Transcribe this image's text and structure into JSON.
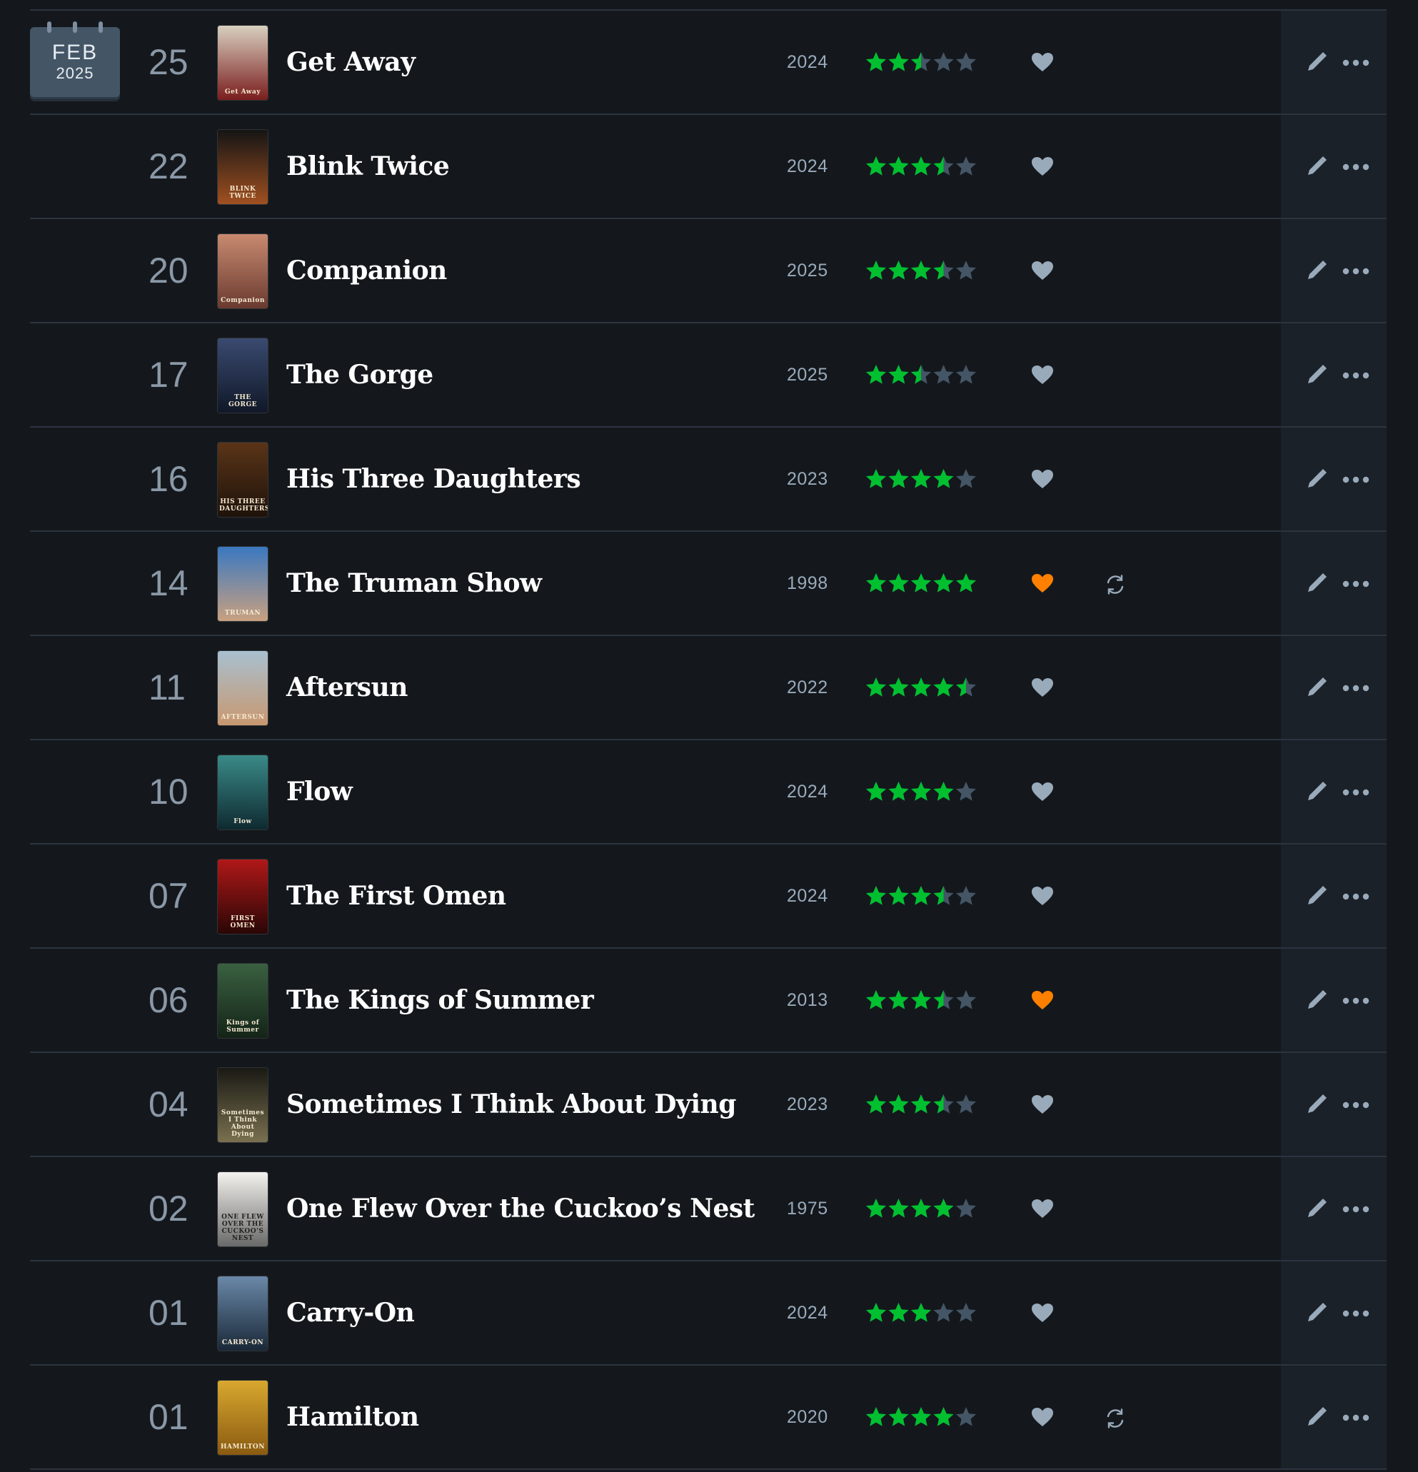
{
  "colors": {
    "background": "#14181c",
    "divider": "#2c3440",
    "star_filled": "#00c030",
    "star_empty": "#445566",
    "heart_liked": "#ff8000",
    "heart_default": "#99aabb"
  },
  "calendar": {
    "month": "FEB",
    "year": "2025"
  },
  "entries": [
    {
      "day": "25",
      "title": "Get Away",
      "year": "2024",
      "rating": 2.5,
      "liked": false,
      "rewatch": false,
      "poster_text": "Get Away",
      "poster_bg": [
        "#d8d0c0",
        "#7a1d1d"
      ]
    },
    {
      "day": "22",
      "title": "Blink Twice",
      "year": "2024",
      "rating": 3.5,
      "liked": false,
      "rewatch": false,
      "poster_text": "BLINK TWICE",
      "poster_bg": [
        "#151515",
        "#a05020"
      ]
    },
    {
      "day": "20",
      "title": "Companion",
      "year": "2025",
      "rating": 3.5,
      "liked": false,
      "rewatch": false,
      "poster_text": "Companion",
      "poster_bg": [
        "#c88a70",
        "#6a3a30"
      ]
    },
    {
      "day": "17",
      "title": "The Gorge",
      "year": "2025",
      "rating": 2.5,
      "liked": false,
      "rewatch": false,
      "poster_text": "THE GORGE",
      "poster_bg": [
        "#3a4a70",
        "#101828"
      ]
    },
    {
      "day": "16",
      "title": "His Three Daughters",
      "year": "2023",
      "rating": 4,
      "liked": false,
      "rewatch": false,
      "poster_text": "HIS THREE DAUGHTERS",
      "poster_bg": [
        "#5a3418",
        "#1e120a"
      ]
    },
    {
      "day": "14",
      "title": "The Truman Show",
      "year": "1998",
      "rating": 5,
      "liked": true,
      "rewatch": true,
      "poster_text": "TRUMAN",
      "poster_bg": [
        "#3a78c0",
        "#c8a080"
      ]
    },
    {
      "day": "11",
      "title": "Aftersun",
      "year": "2022",
      "rating": 4.5,
      "liked": false,
      "rewatch": false,
      "poster_text": "AFTERSUN",
      "poster_bg": [
        "#a8c0d0",
        "#c89870"
      ]
    },
    {
      "day": "10",
      "title": "Flow",
      "year": "2024",
      "rating": 4,
      "liked": false,
      "rewatch": false,
      "poster_text": "Flow",
      "poster_bg": [
        "#3a8a88",
        "#0e2a30"
      ]
    },
    {
      "day": "07",
      "title": "The First Omen",
      "year": "2024",
      "rating": 3.5,
      "liked": false,
      "rewatch": false,
      "poster_text": "FIRST OMEN",
      "poster_bg": [
        "#b01818",
        "#2a0606"
      ]
    },
    {
      "day": "06",
      "title": "The Kings of Summer",
      "year": "2013",
      "rating": 3.5,
      "liked": true,
      "rewatch": false,
      "poster_text": "Kings of Summer",
      "poster_bg": [
        "#3a6040",
        "#142418"
      ]
    },
    {
      "day": "04",
      "title": "Sometimes I Think About Dying",
      "year": "2023",
      "rating": 3.5,
      "liked": false,
      "rewatch": false,
      "poster_text": "Sometimes I Think About Dying",
      "poster_bg": [
        "#1a1a14",
        "#7a7050"
      ]
    },
    {
      "day": "02",
      "title": "One Flew Over the Cuckoo’s Nest",
      "year": "1975",
      "rating": 4,
      "liked": false,
      "rewatch": false,
      "poster_text": "ONE FLEW OVER THE CUCKOO'S NEST",
      "poster_bg": [
        "#f4f2ee",
        "#6a6a6a"
      ]
    },
    {
      "day": "01",
      "title": "Carry-On",
      "year": "2024",
      "rating": 3,
      "liked": false,
      "rewatch": false,
      "poster_text": "CARRY-ON",
      "poster_bg": [
        "#6a88a8",
        "#1a2838"
      ]
    },
    {
      "day": "01",
      "title": "Hamilton",
      "year": "2020",
      "rating": 4,
      "liked": false,
      "rewatch": true,
      "poster_text": "HAMILTON",
      "poster_bg": [
        "#d8a830",
        "#8a5a10"
      ]
    }
  ]
}
